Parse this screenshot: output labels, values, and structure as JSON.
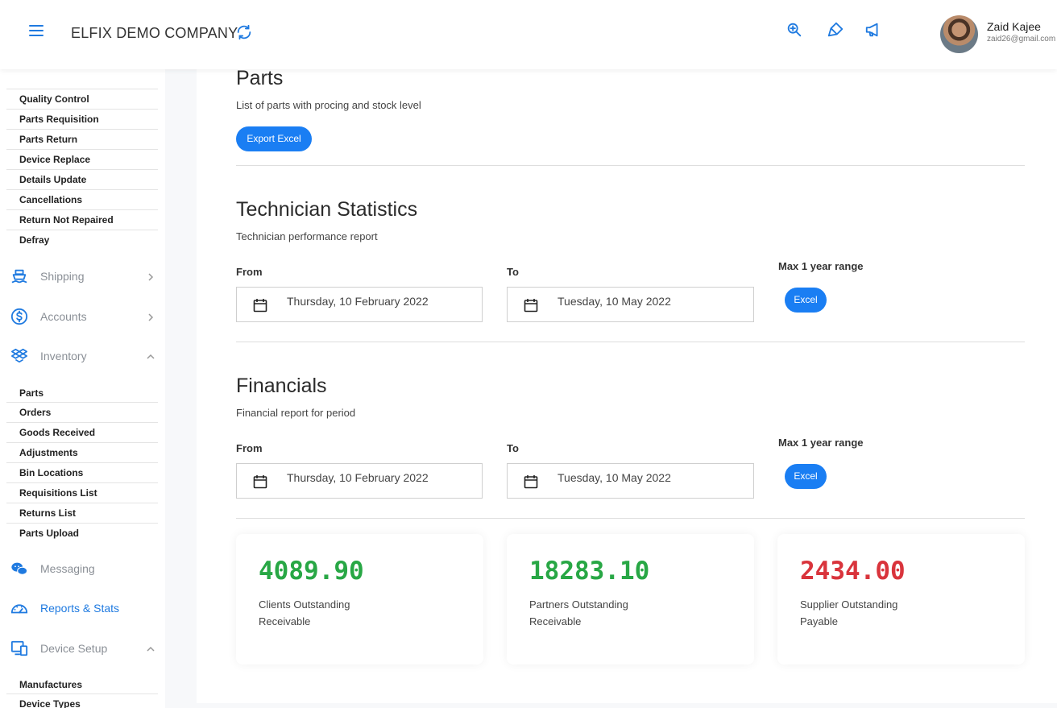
{
  "header": {
    "company": "ELFIX DEMO COMPANY",
    "user_name": "Zaid Kajee",
    "user_email": "zaid26@gmail.com"
  },
  "sidebar": {
    "sub_items_top": [
      "Quality Control",
      "Parts Requisition",
      "Parts Return",
      "Device Replace",
      "Details Update",
      "Cancellations",
      "Return Not Repaired",
      "Defray"
    ],
    "shipping": "Shipping",
    "accounts": "Accounts",
    "inventory": "Inventory",
    "inventory_items": [
      "Parts",
      "Orders",
      "Goods Received",
      "Adjustments",
      "Bin Locations",
      "Requisitions List",
      "Returns List",
      "Parts Upload"
    ],
    "messaging": "Messaging",
    "reports": "Reports & Stats",
    "device_setup": "Device Setup",
    "device_items": [
      "Manufactures",
      "Device Types"
    ]
  },
  "parts": {
    "title": "Parts",
    "subtitle": "List of parts with procing and stock level",
    "export_label": "Export Excel"
  },
  "technician": {
    "title": "Technician Statistics",
    "subtitle": "Technician performance report",
    "from_label": "From",
    "to_label": "To",
    "from_value": "Thursday, 10 February 2022",
    "to_value": "Tuesday, 10 May 2022",
    "range_label": "Max 1 year range",
    "excel_label": "Excel"
  },
  "financials": {
    "title": "Financials",
    "subtitle": "Financial report for period",
    "from_label": "From",
    "to_label": "To",
    "from_value": "Thursday, 10 February 2022",
    "to_value": "Tuesday, 10 May 2022",
    "range_label": "Max 1 year range",
    "excel_label": "Excel"
  },
  "cards": [
    {
      "value": "4089.90",
      "line1": "Clients Outstanding",
      "line2": "Receivable",
      "color": "#28a745"
    },
    {
      "value": "18283.10",
      "line1": "Partners Outstanding",
      "line2": "Receivable",
      "color": "#28a745"
    },
    {
      "value": "2434.00",
      "line1": "Supplier Outstanding",
      "line2": "Payable",
      "color": "#d9343c"
    }
  ],
  "colors": {
    "accent": "#1a7ef3",
    "positive": "#28a745",
    "negative": "#d9343c"
  }
}
